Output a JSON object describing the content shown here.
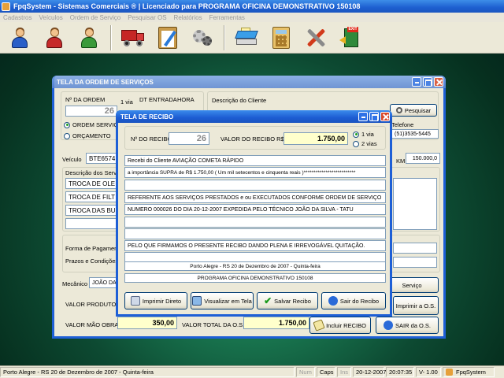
{
  "app": {
    "title": "FpqSystem - Sistemas Comerciais ®  |  Licenciado para  PROGRAMA OFICINA DEMONSTRATIVO 150108"
  },
  "menu": [
    "Cadastros",
    "Veículos",
    "Ordem de Serviço",
    "Pesquisar OS",
    "Relatórios",
    "Ferramentas"
  ],
  "toolbar_icons": [
    "person-blue-icon",
    "person-red-icon",
    "person-green-icon",
    "truck-icon",
    "clipboard-icon",
    "gears-icon",
    "scanner-icon",
    "calculator-icon",
    "tools-icon",
    "exit-icon"
  ],
  "os_window": {
    "title": "TELA DA ORDEM DE SERVIÇOS",
    "nro_ordem_label": "Nº DA ORDEM",
    "nro_ordem": "26",
    "via_label": "1 via",
    "dt_entrada_label": "DT ENTRADA",
    "hora_label": "HORA",
    "desc_cliente_label": "Descrição do Cliente",
    "pesquisar_label": "Pesquisar",
    "ordem_servico_label": "ORDEM SERVIÇO",
    "orcamento_label": "ORÇAMENTO",
    "telefone_label": "Telefone",
    "telefone": "(51)3535-5445",
    "veiculo_label": "Veículo",
    "veiculo": "BTE6574",
    "km_label": "KM",
    "km": "150.000,0",
    "desc_servicos_label": "Descrição dos Serviços",
    "servicos": [
      "TROCA DE OLE",
      "TROCA DE FILT",
      "TROCA DAS BU"
    ],
    "forma_pagamento_label": "Forma de Pagamento",
    "prazos_label": "Prazos e  Condições:",
    "mecanico_label": "Mecânico",
    "mecanico": "JOÃO DA S",
    "servico_btn": "Serviço",
    "valor_produtos_label": "VALOR PRODUTOS",
    "imprimir_os_btn": "Imprimir a O.S.",
    "valor_mao_obra_label": "VALOR MÃO OBRA",
    "valor_mao_obra": "350,00",
    "valor_total_label": "VALOR TOTAL DA O.S.",
    "valor_total": "1.750,00",
    "incluir_recibo_btn": "Incluir RECIBO",
    "sair_os_btn": "SAIR da O.S."
  },
  "recibo_window": {
    "title": "TELA DE RECIBO",
    "nro_recibo_label": "Nº DO RECIBO",
    "nro_recibo": "26",
    "valor_recibo_label": "VALOR DO RECIBO R$",
    "valor_recibo": "1.750,00",
    "via1_label": "1 via",
    "via2_label": "2 vias",
    "lines": [
      "Recebi do Cliente  AVIAÇÃO COMETA RÁPIDO",
      "a importância SUPRA de R$    1.750,00 ( Um mil setecentos e cinquenta  reais )**************************",
      "",
      "REFERENTE AOS SERVIÇOS PRESTADOS e ou EXECUTADOS CONFORME ORDEM DE SERVIÇO",
      "NUMERO 000026 DO DIA 20-12-2007  EXPEDIDA PELO TÉCNICO JOÃO DA SILVA - TATU",
      "",
      "",
      "PELO QUE FIRMAMOS O PRESENTE RECIBO DANDO PLENA E IRREVOGÁVEL QUITAÇÃO.",
      "",
      "Porto Alegre - RS 20 de Dezembro de 2007 - Quinta-feira",
      "PROGRAMA OFICINA DEMONSTRATIVO 150108"
    ],
    "btn_imprimir": "Imprimir Direto",
    "btn_visualizar": "Visualizar em Tela",
    "btn_salvar": "Salvar Recibo",
    "btn_sair": "Sair do Recibo"
  },
  "statusbar": {
    "city_date": "Porto Alegre - RS 20 de Dezembro de 2007 - Quinta-feira",
    "num": "Num",
    "caps": "Caps",
    "ins": "Ins",
    "date": "20-12-2007",
    "time": "20:07:35",
    "version": "V-  1.00",
    "app": "FpqSystem"
  }
}
